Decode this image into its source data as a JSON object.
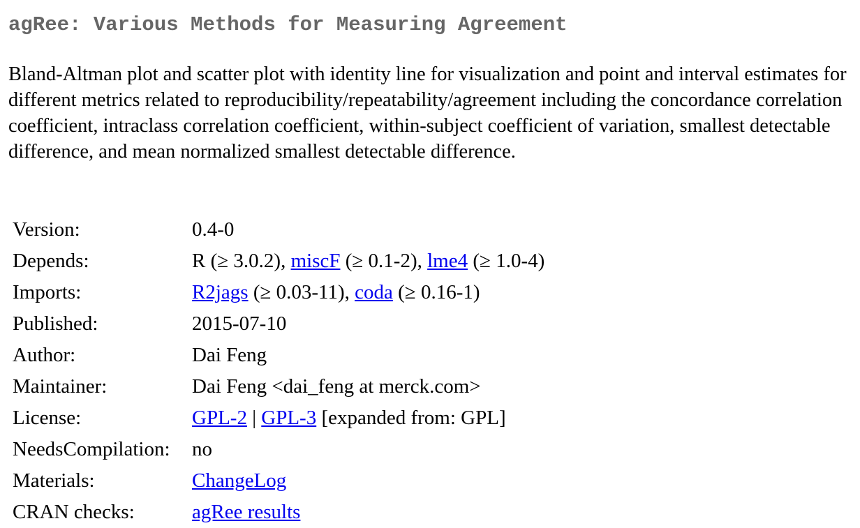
{
  "package": {
    "title": "agRee: Various Methods for Measuring Agreement",
    "description": "Bland-Altman plot and scatter plot with identity line for visualization and point and interval estimates for different metrics related to reproducibility/repeatability/agreement including the concordance correlation coefficient, intraclass correlation coefficient, within-subject coefficient of variation, smallest detectable difference, and mean normalized smallest detectable difference."
  },
  "details": {
    "version": {
      "label": "Version:",
      "value": "0.4-0"
    },
    "depends": {
      "label": "Depends:",
      "r": "R (≥ 3.0.2), ",
      "link1": "miscF",
      "sep1": " (≥ 0.1-2), ",
      "link2": "lme4",
      "sep2": " (≥ 1.0-4)"
    },
    "imports": {
      "label": "Imports:",
      "link1": "R2jags",
      "sep1": " (≥ 0.03-11), ",
      "link2": "coda",
      "sep2": " (≥ 0.16-1)"
    },
    "published": {
      "label": "Published:",
      "value": "2015-07-10"
    },
    "author": {
      "label": "Author:",
      "value": "Dai Feng"
    },
    "maintainer": {
      "label": "Maintainer:",
      "value": "Dai Feng <dai_feng at merck.com>"
    },
    "license": {
      "label": "License:",
      "link1": "GPL-2",
      "sep1": " | ",
      "link2": "GPL-3",
      "suffix": " [expanded from: GPL]"
    },
    "needs_compilation": {
      "label": "NeedsCompilation:",
      "value": "no"
    },
    "materials": {
      "label": "Materials:",
      "link": "ChangeLog"
    },
    "cran_checks": {
      "label": "CRAN checks:",
      "link": "agRee results"
    }
  },
  "colors": {
    "title": "#666666",
    "link": "#0000ee",
    "text": "#000000",
    "background": "#ffffff"
  }
}
